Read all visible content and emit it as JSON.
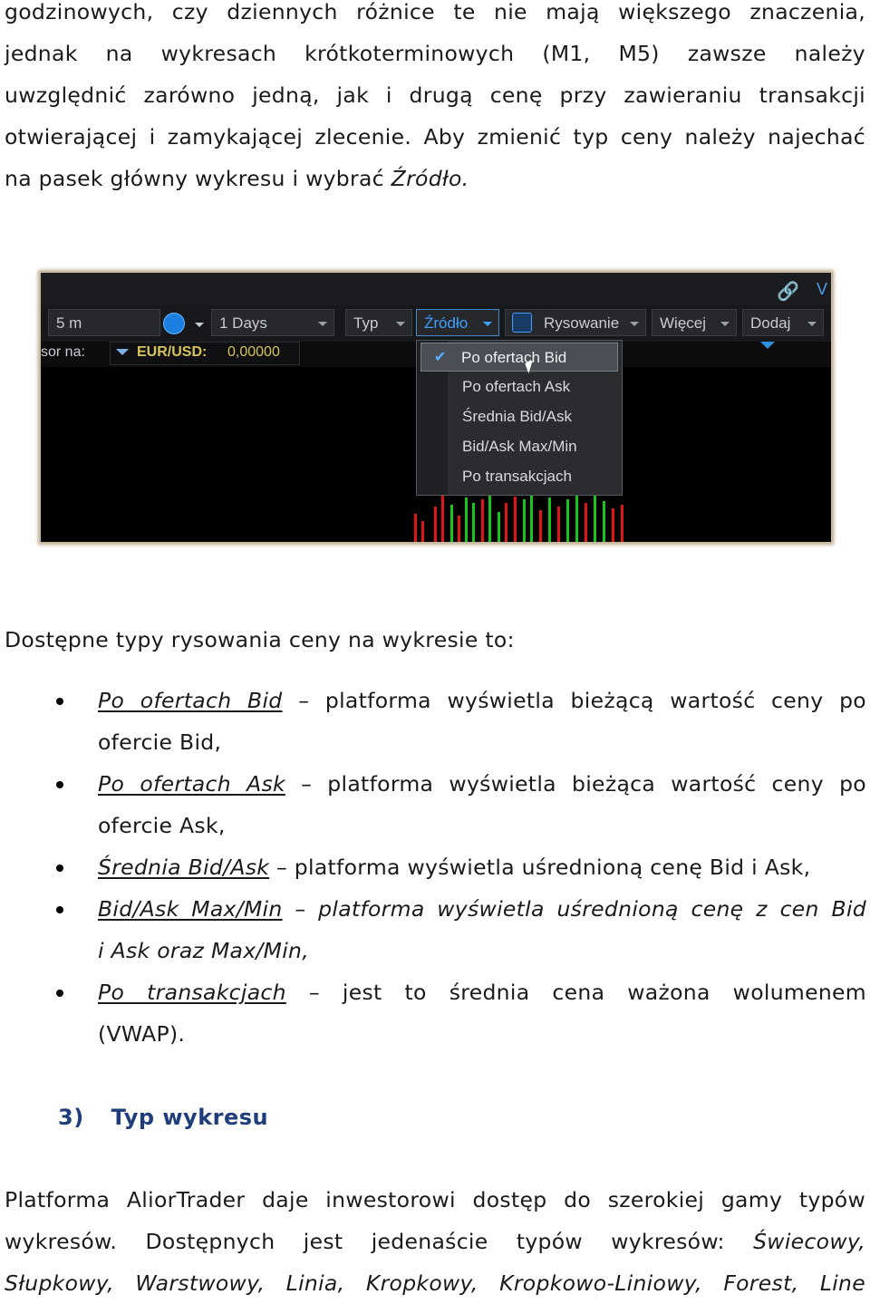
{
  "intro": {
    "line1": "godzinowych, czy dziennych różnice te nie mają większego znaczenia,",
    "line2": "jednak na wykresach krótkoterminowych (M1, M5) zawsze należy",
    "line3": "uwzględnić zarówno jedną, jak i drugą cenę przy zawieraniu transakcji",
    "line4": "otwierającej i zamykającej zlecenie. Aby zmienić typ ceny należy najechać",
    "line5_a": "na pasek główny wykresu i wybrać ",
    "line5_b": "Źródło."
  },
  "screenshot": {
    "interval": "5 m",
    "range": "1 Days",
    "type_label": "Typ",
    "source_label": "Źródło",
    "drawing_label": "Rysowanie",
    "more_label": "Więcej",
    "add_label": "Dodaj",
    "top_right_text": "V",
    "info_label": "sor na:",
    "pair": "EUR/USD:",
    "pair_value": "0,00000",
    "menu_items": [
      "Po ofertach Bid",
      "Po ofertach Ask",
      "Średnia Bid/Ask",
      "Bid/Ask Max/Min",
      "Po transakcjach"
    ],
    "selected_index": 0,
    "colors": {
      "up": "#17c41a",
      "down": "#e01515",
      "accent": "#3ea0ff"
    }
  },
  "types_intro": "Dostępne typy rysowania ceny na wykresie to:",
  "list": [
    {
      "name": "Po ofertach Bid",
      "desc1": "– platforma wyświetla bieżącą wartość ceny po",
      "desc2": "ofercie Bid,"
    },
    {
      "name": "Po ofertach Ask",
      "desc1": "– platforma wyświetla bieżąca wartość ceny po",
      "desc2": "ofercie Ask,"
    },
    {
      "name": "Średnia Bid/Ask",
      "desc1": "– platforma wyświetla uśrednioną cenę Bid i Ask,"
    },
    {
      "name": "Bid/Ask Max/Min",
      "desc1": "– platforma wyświetla uśrednioną cenę z cen Bid",
      "desc2": "i Ask oraz Max/Min,"
    },
    {
      "name": "Po transakcjach",
      "desc1": "– jest to średnia cena ważona wolumenem",
      "desc2": "(VWAP)."
    }
  ],
  "section": {
    "number": "3)",
    "title": "Typ wykresu"
  },
  "outro": {
    "line1": "Platforma AliorTrader daje inwestorowi dostęp do szerokiej gamy typów",
    "line2_a": "wykresów. Dostępnych jest jedenaście typów wykresów: ",
    "line2_b": "Świecowy,",
    "line3": "Słupkowy, Warstwowy, Linia, Kropkowy, Kropkowo-Liniowy, Forest, Line"
  }
}
